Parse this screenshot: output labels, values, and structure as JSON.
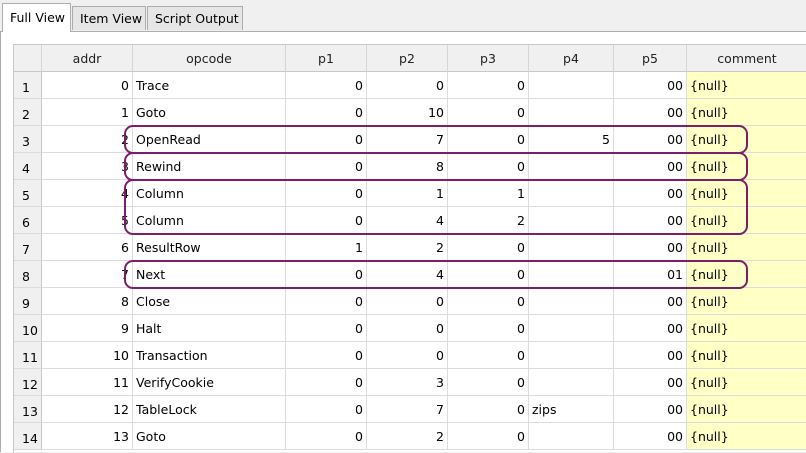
{
  "tabs": [
    {
      "label": "Full View",
      "active": true
    },
    {
      "label": "Item View",
      "active": false
    },
    {
      "label": "Script Output",
      "active": false
    }
  ],
  "columns": [
    "",
    "addr",
    "opcode",
    "p1",
    "p2",
    "p3",
    "p4",
    "p5",
    "comment"
  ],
  "rows": [
    [
      "1",
      "0",
      "Trace",
      "0",
      "0",
      "0",
      "",
      "00",
      "{null}"
    ],
    [
      "2",
      "1",
      "Goto",
      "0",
      "10",
      "0",
      "",
      "00",
      "{null}"
    ],
    [
      "3",
      "2",
      "OpenRead",
      "0",
      "7",
      "0",
      "5",
      "00",
      "{null}"
    ],
    [
      "4",
      "3",
      "Rewind",
      "0",
      "8",
      "0",
      "",
      "00",
      "{null}"
    ],
    [
      "5",
      "4",
      "Column",
      "0",
      "1",
      "1",
      "",
      "00",
      "{null}"
    ],
    [
      "6",
      "5",
      "Column",
      "0",
      "4",
      "2",
      "",
      "00",
      "{null}"
    ],
    [
      "7",
      "6",
      "ResultRow",
      "1",
      "2",
      "0",
      "",
      "00",
      "{null}"
    ],
    [
      "8",
      "7",
      "Next",
      "0",
      "4",
      "0",
      "",
      "01",
      "{null}"
    ],
    [
      "9",
      "8",
      "Close",
      "0",
      "0",
      "0",
      "",
      "00",
      "{null}"
    ],
    [
      "10",
      "9",
      "Halt",
      "0",
      "0",
      "0",
      "",
      "00",
      "{null}"
    ],
    [
      "11",
      "10",
      "Transaction",
      "0",
      "0",
      "0",
      "",
      "00",
      "{null}"
    ],
    [
      "12",
      "11",
      "VerifyCookie",
      "0",
      "3",
      "0",
      "",
      "00",
      "{null}"
    ],
    [
      "13",
      "12",
      "TableLock",
      "0",
      "7",
      "0",
      "zips",
      "00",
      "{null}"
    ],
    [
      "14",
      "13",
      "Goto",
      "0",
      "2",
      "0",
      "",
      "00",
      "{null}"
    ]
  ],
  "colors": {
    "highlight": "#7b1f6a",
    "comment_bg": "#ffffc6"
  }
}
